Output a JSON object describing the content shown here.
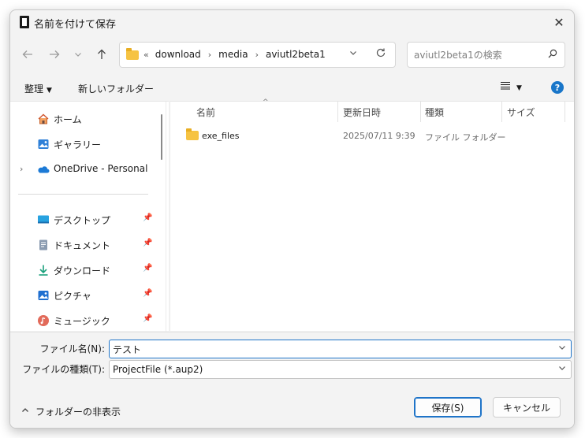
{
  "window": {
    "title": "名前を付けて保存",
    "close_glyph": "✕"
  },
  "navbar": {
    "breadcrumbs": [
      "download",
      "media",
      "aviutl2beta1"
    ],
    "search_placeholder": "aviutl2beta1の検索"
  },
  "commandbar": {
    "organize_label": "整理",
    "new_folder_label": "新しいフォルダー"
  },
  "sidebar": {
    "items": [
      {
        "label": "ホーム",
        "icon": "home-icon"
      },
      {
        "label": "ギャラリー",
        "icon": "gallery-icon"
      },
      {
        "label": "OneDrive - Personal",
        "icon": "onedrive-icon"
      },
      {
        "label": "デスクトップ",
        "icon": "desktop-icon",
        "pinned": true
      },
      {
        "label": "ドキュメント",
        "icon": "documents-icon",
        "pinned": true
      },
      {
        "label": "ダウンロード",
        "icon": "downloads-icon",
        "pinned": true
      },
      {
        "label": "ピクチャ",
        "icon": "pictures-icon",
        "pinned": true
      },
      {
        "label": "ミュージック",
        "icon": "music-icon",
        "pinned": true
      }
    ]
  },
  "content": {
    "columns": [
      "名前",
      "更新日時",
      "種類",
      "サイズ"
    ],
    "rows": [
      {
        "name": "exe_files",
        "modified": "2025/07/11 9:39",
        "type": "ファイル フォルダー",
        "size": ""
      }
    ]
  },
  "form": {
    "filename_label": "ファイル名(N):",
    "filename_value": "テスト",
    "filetype_label": "ファイルの種類(T):",
    "filetype_value": "ProjectFile (*.aup2)"
  },
  "footer": {
    "hide_folders_label": "フォルダーの非表示",
    "save_label": "保存(S)",
    "cancel_label": "キャンセル"
  },
  "colors": {
    "accent": "#1f74c8",
    "folder": "#f6c343"
  }
}
